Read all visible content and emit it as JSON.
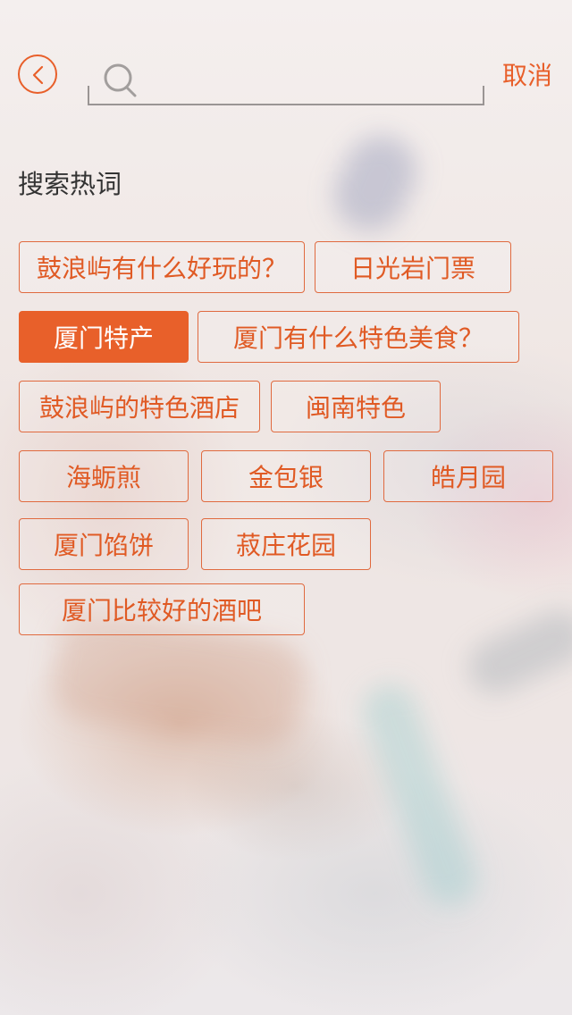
{
  "header": {
    "search_placeholder": "",
    "cancel_label": "取消"
  },
  "hot": {
    "title": "搜索热词",
    "tags": [
      "鼓浪屿有什么好玩的？",
      "日光岩门票",
      "厦门特产",
      "厦门有什么特色美食？",
      "鼓浪屿的特色酒店",
      "闽南特色",
      "海蛎煎",
      "金包银",
      "皓月园",
      "厦门馅饼",
      "菽庄花园",
      "厦门比较好的酒吧"
    ],
    "active_tag": "厦门特产"
  },
  "colors": {
    "accent": "#e8602a",
    "text": "#333333",
    "search_line": "#9a9594"
  },
  "icons": {
    "back": "chevron-left-circle-icon",
    "search": "search-icon"
  }
}
